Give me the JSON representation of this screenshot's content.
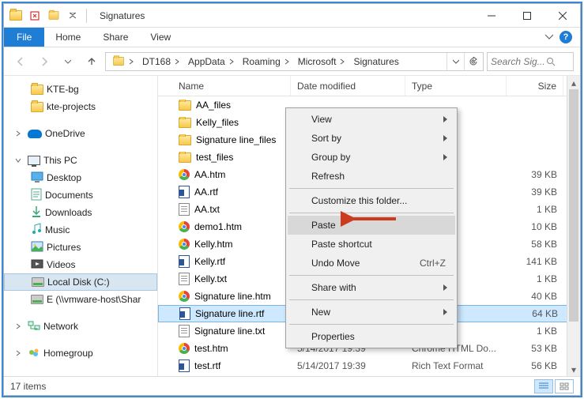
{
  "title": "Signatures",
  "ribbon": {
    "file": "File",
    "tabs": [
      "Home",
      "Share",
      "View"
    ]
  },
  "breadcrumbs": [
    "DT168",
    "AppData",
    "Roaming",
    "Microsoft",
    "Signatures"
  ],
  "search_placeholder": "Search Sig...",
  "sidebar": {
    "quick": [
      {
        "label": "KTE-bg",
        "icon": "folder"
      },
      {
        "label": "kte-projects",
        "icon": "folder"
      }
    ],
    "onedrive": "OneDrive",
    "thispc": "This PC",
    "thispc_items": [
      {
        "label": "Desktop"
      },
      {
        "label": "Documents"
      },
      {
        "label": "Downloads"
      },
      {
        "label": "Music"
      },
      {
        "label": "Pictures"
      },
      {
        "label": "Videos"
      },
      {
        "label": "Local Disk (C:)",
        "selected": true
      },
      {
        "label": "E (\\\\vmware-host\\Shar"
      }
    ],
    "network": "Network",
    "homegroup": "Homegroup"
  },
  "columns": {
    "name": "Name",
    "date": "Date modified",
    "type": "Type",
    "size": "Size"
  },
  "files": [
    {
      "name": "AA_files",
      "icon": "folder",
      "date": "",
      "type": "",
      "size": ""
    },
    {
      "name": "Kelly_files",
      "icon": "folder",
      "date": "",
      "type": "",
      "size": ""
    },
    {
      "name": "Signature line_files",
      "icon": "folder",
      "date": "",
      "type": "",
      "size": ""
    },
    {
      "name": "test_files",
      "icon": "folder",
      "date": "",
      "type": "",
      "size": ""
    },
    {
      "name": "AA.htm",
      "icon": "chrome",
      "date": "",
      "type": "L Do...",
      "size": "39 KB"
    },
    {
      "name": "AA.rtf",
      "icon": "rtf",
      "date": "",
      "type": "at",
      "size": "39 KB"
    },
    {
      "name": "AA.txt",
      "icon": "txt",
      "date": "",
      "type": "t",
      "size": "1 KB"
    },
    {
      "name": "demo1.htm",
      "icon": "chrome",
      "date": "",
      "type": "L Do...",
      "size": "10 KB"
    },
    {
      "name": "Kelly.htm",
      "icon": "chrome",
      "date": "",
      "type": "L Do...",
      "size": "58 KB"
    },
    {
      "name": "Kelly.rtf",
      "icon": "rtf",
      "date": "",
      "type": "at",
      "size": "141 KB"
    },
    {
      "name": "Kelly.txt",
      "icon": "txt",
      "date": "",
      "type": "t",
      "size": "1 KB"
    },
    {
      "name": "Signature line.htm",
      "icon": "chrome",
      "date": "",
      "type": "L Do...",
      "size": "40 KB"
    },
    {
      "name": "Signature line.rtf",
      "icon": "rtf",
      "date": "",
      "type": "at",
      "size": "64 KB",
      "selected": true
    },
    {
      "name": "Signature line.txt",
      "icon": "txt",
      "date": "",
      "type": "t",
      "size": "1 KB"
    },
    {
      "name": "test.htm",
      "icon": "chrome",
      "date": "5/14/2017 19:39",
      "type": "Chrome HTML Do...",
      "size": "53 KB"
    },
    {
      "name": "test.rtf",
      "icon": "rtf",
      "date": "5/14/2017 19:39",
      "type": "Rich Text Format",
      "size": "56 KB"
    }
  ],
  "status": "17 items",
  "context_menu": [
    {
      "label": "View",
      "sub": true
    },
    {
      "label": "Sort by",
      "sub": true
    },
    {
      "label": "Group by",
      "sub": true
    },
    {
      "label": "Refresh"
    },
    {
      "sep": true
    },
    {
      "label": "Customize this folder..."
    },
    {
      "sep": true
    },
    {
      "label": "Paste",
      "hover": true
    },
    {
      "label": "Paste shortcut"
    },
    {
      "label": "Undo Move",
      "shortcut": "Ctrl+Z"
    },
    {
      "sep": true
    },
    {
      "label": "Share with",
      "sub": true
    },
    {
      "sep": true
    },
    {
      "label": "New",
      "sub": true
    },
    {
      "sep": true
    },
    {
      "label": "Properties"
    }
  ]
}
